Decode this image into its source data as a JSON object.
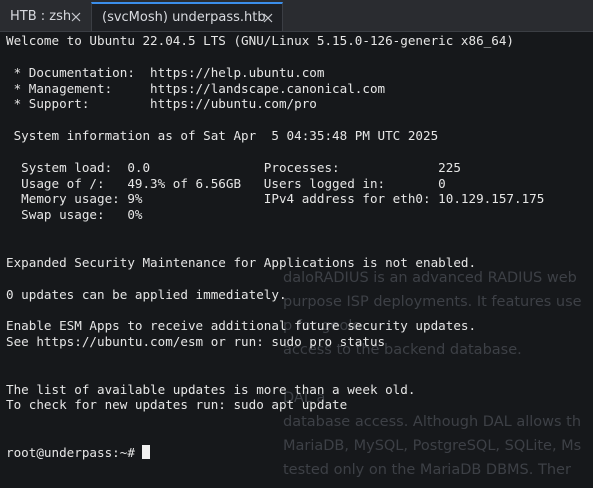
{
  "tabs": [
    {
      "label": "HTB : zsh",
      "active": false,
      "close_icon": "close-icon"
    },
    {
      "label": "(svcMosh) underpass.htb",
      "active": true,
      "close_icon": "close-icon"
    }
  ],
  "terminal": {
    "lines": [
      "Welcome to Ubuntu 22.04.5 LTS (GNU/Linux 5.15.0-126-generic x86_64)",
      "",
      " * Documentation:  https://help.ubuntu.com",
      " * Management:     https://landscape.canonical.com",
      " * Support:        https://ubuntu.com/pro",
      "",
      " System information as of Sat Apr  5 04:35:48 PM UTC 2025",
      "",
      "  System load:  0.0               Processes:             225",
      "  Usage of /:   49.3% of 6.56GB   Users logged in:       0",
      "  Memory usage: 9%                IPv4 address for eth0: 10.129.157.175",
      "  Swap usage:   0%",
      "",
      "",
      "Expanded Security Maintenance for Applications is not enabled.",
      "",
      "0 updates can be applied immediately.",
      "",
      "Enable ESM Apps to receive additional future security updates.",
      "See https://ubuntu.com/esm or run: sudo pro status",
      "",
      "",
      "The list of available updates is more than a week old.",
      "To check for new updates run: sudo apt update",
      "",
      ""
    ],
    "prompt": "root@underpass:~# "
  },
  "background_page": {
    "lines": [
      "daloRADIUS is an advanced RADIUS web",
      "purpose ISP deployments. It features use",
      "                                 p for geolo",
      "access to the backend database.",
      "",
      "                              DAL    a",
      "database access. Although DAL allows th",
      "MariaDB, MySQL, PostgreSQL, SQLite, Ms",
      "tested only on the MariaDB DBMS. Ther"
    ]
  },
  "colors": {
    "tab_accent": "#3b8eea",
    "terminal_bg": "#16181b",
    "terminal_fg": "#e6e6e6"
  }
}
